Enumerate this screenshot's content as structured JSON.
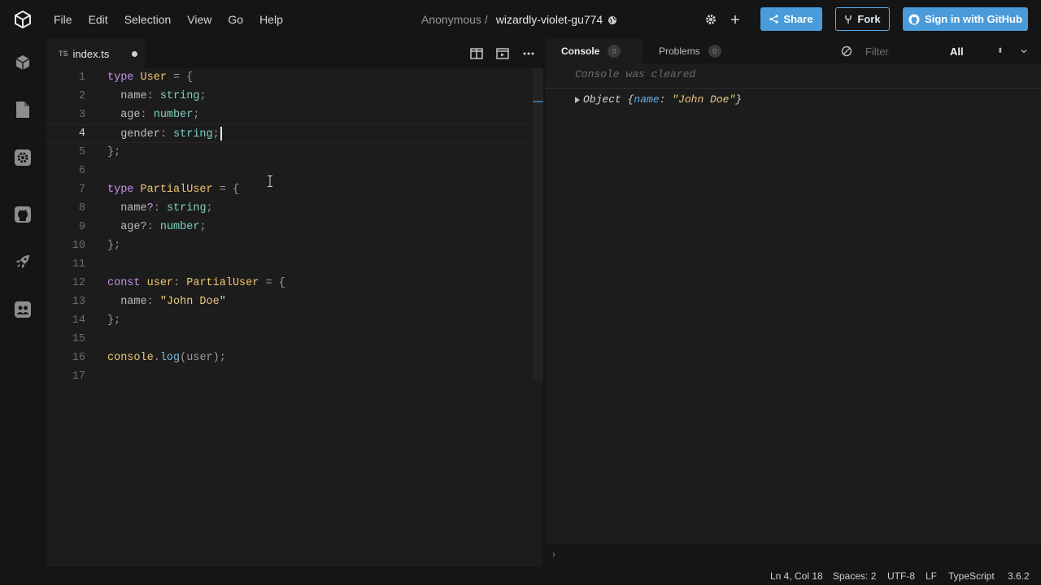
{
  "menu": [
    "File",
    "Edit",
    "Selection",
    "View",
    "Go",
    "Help"
  ],
  "breadcrumb": {
    "owner": "Anonymous /",
    "sandbox": "wizardly-violet-gu774"
  },
  "header": {
    "share_label": "Share",
    "fork_label": "Fork",
    "signin_label": "Sign in with GitHub"
  },
  "activity_icons": [
    "cube-icon",
    "file-icon",
    "settings-icon",
    "github-icon",
    "rocket-icon",
    "people-icon"
  ],
  "editor": {
    "tab_lang": "TS",
    "tab_name": "index.ts",
    "current_line": 4,
    "lines": [
      {
        "n": "1",
        "code": "type User = {"
      },
      {
        "n": "2",
        "code": "  name: string;"
      },
      {
        "n": "3",
        "code": "  age: number;"
      },
      {
        "n": "4",
        "code": "  gender: string;"
      },
      {
        "n": "5",
        "code": "};"
      },
      {
        "n": "6",
        "code": ""
      },
      {
        "n": "7",
        "code": "type PartialUser = {"
      },
      {
        "n": "8",
        "code": "  name?: string;"
      },
      {
        "n": "9",
        "code": "  age?: number;"
      },
      {
        "n": "10",
        "code": "};"
      },
      {
        "n": "11",
        "code": ""
      },
      {
        "n": "12",
        "code": "const user: PartialUser = {"
      },
      {
        "n": "13",
        "code": "  name: \"John Doe\""
      },
      {
        "n": "14",
        "code": "};"
      },
      {
        "n": "15",
        "code": ""
      },
      {
        "n": "16",
        "code": "console.log(user);"
      },
      {
        "n": "17",
        "code": ""
      }
    ]
  },
  "panel": {
    "console_tab": "Console",
    "console_count": "0",
    "problems_tab": "Problems",
    "problems_count": "0",
    "filter_placeholder": "Filter",
    "level": "All",
    "level_arrows": "⬍",
    "cleared_msg": "Console was cleared",
    "log": {
      "prefix": "Object {",
      "key": "name",
      "sep": ": ",
      "value": "\"John Doe\"",
      "suffix": "}"
    },
    "prompt": "›"
  },
  "status": {
    "position": "Ln 4, Col 18",
    "spaces": "Spaces: 2",
    "encoding": "UTF-8",
    "eol": "LF",
    "language": "TypeScript",
    "version": "3.6.2"
  },
  "colors": {
    "accent": "#4a9bd9",
    "background": "#151515",
    "editor_bg": "#1c1c1c"
  }
}
